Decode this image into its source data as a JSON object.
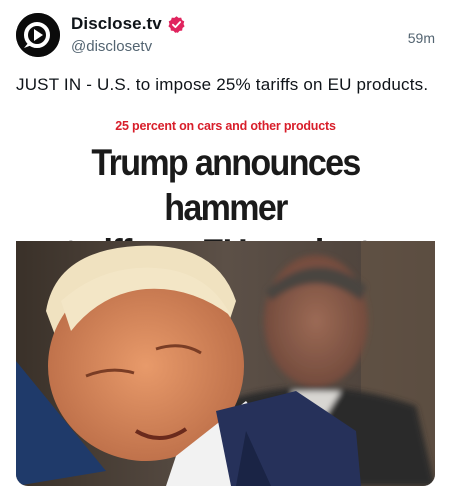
{
  "post": {
    "display_name": "Disclose.tv",
    "handle": "@disclosetv",
    "time": "59m",
    "text": "JUST IN - U.S. to impose 25% tariffs on EU products."
  },
  "icons": {
    "avatar": "disclose-logo-icon",
    "verified": "verified-badge-icon"
  },
  "media": {
    "kicker": "25 percent on cars and other products",
    "headline_line1": "Trump announces hammer",
    "headline_line2": "tariffs on EU products",
    "photo": "news-photo"
  },
  "colors": {
    "verified_badge": "#e0245e",
    "kicker": "#d81e2a",
    "text_primary": "#0f1419",
    "text_secondary": "#536471"
  }
}
